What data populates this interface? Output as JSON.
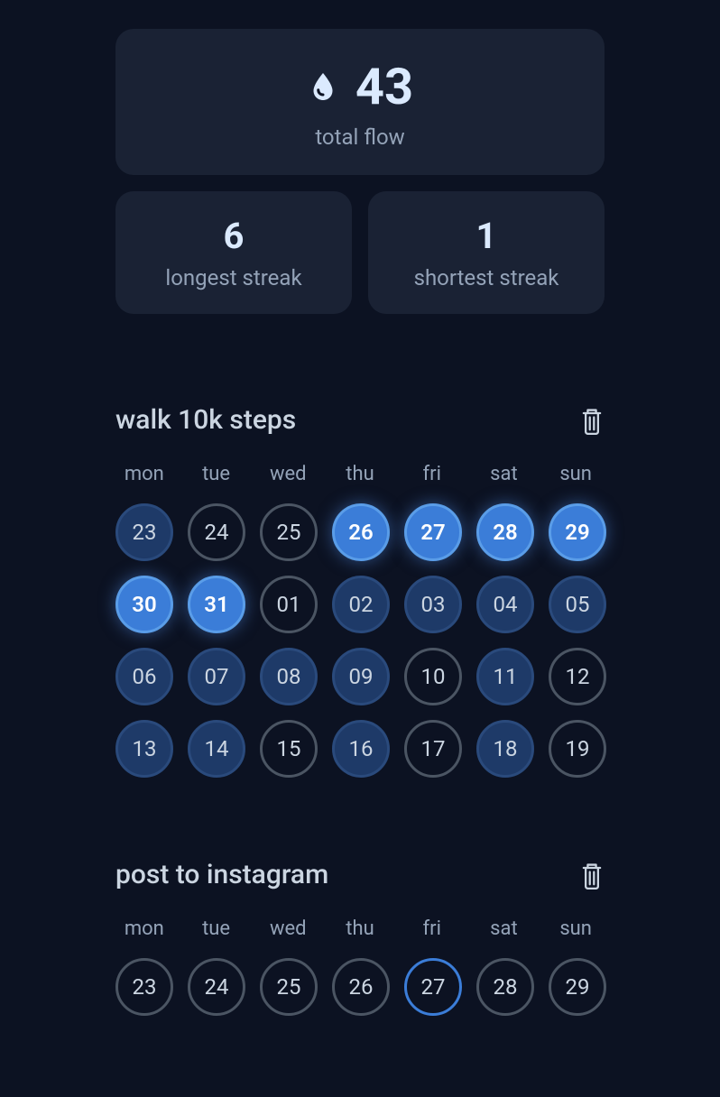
{
  "stats": {
    "totalFlow": {
      "value": "43",
      "label": "total flow"
    },
    "longestStreak": {
      "value": "6",
      "label": "longest streak"
    },
    "shortestStreak": {
      "value": "1",
      "label": "shortest streak"
    }
  },
  "dayLabels": [
    "mon",
    "tue",
    "wed",
    "thu",
    "fri",
    "sat",
    "sun"
  ],
  "habits": [
    {
      "title": "walk 10k steps",
      "days": [
        {
          "num": "23",
          "state": "filled-dim"
        },
        {
          "num": "24",
          "state": "empty"
        },
        {
          "num": "25",
          "state": "empty"
        },
        {
          "num": "26",
          "state": "filled-bright"
        },
        {
          "num": "27",
          "state": "filled-bright"
        },
        {
          "num": "28",
          "state": "filled-bright"
        },
        {
          "num": "29",
          "state": "filled-bright"
        },
        {
          "num": "30",
          "state": "filled-bright"
        },
        {
          "num": "31",
          "state": "filled-bright"
        },
        {
          "num": "01",
          "state": "empty"
        },
        {
          "num": "02",
          "state": "filled-dim"
        },
        {
          "num": "03",
          "state": "filled-dim"
        },
        {
          "num": "04",
          "state": "filled-dim"
        },
        {
          "num": "05",
          "state": "filled-dim"
        },
        {
          "num": "06",
          "state": "filled-dim"
        },
        {
          "num": "07",
          "state": "filled-dim"
        },
        {
          "num": "08",
          "state": "filled-dim"
        },
        {
          "num": "09",
          "state": "filled-dim"
        },
        {
          "num": "10",
          "state": "empty"
        },
        {
          "num": "11",
          "state": "filled-dim"
        },
        {
          "num": "12",
          "state": "empty"
        },
        {
          "num": "13",
          "state": "filled-dim"
        },
        {
          "num": "14",
          "state": "filled-dim"
        },
        {
          "num": "15",
          "state": "empty"
        },
        {
          "num": "16",
          "state": "filled-dim"
        },
        {
          "num": "17",
          "state": "empty"
        },
        {
          "num": "18",
          "state": "filled-dim"
        },
        {
          "num": "19",
          "state": "empty"
        }
      ]
    },
    {
      "title": "post to instagram",
      "days": [
        {
          "num": "23",
          "state": "empty"
        },
        {
          "num": "24",
          "state": "empty"
        },
        {
          "num": "25",
          "state": "empty"
        },
        {
          "num": "26",
          "state": "empty"
        },
        {
          "num": "27",
          "state": "outline-blue"
        },
        {
          "num": "28",
          "state": "empty"
        },
        {
          "num": "29",
          "state": "empty"
        }
      ]
    }
  ]
}
